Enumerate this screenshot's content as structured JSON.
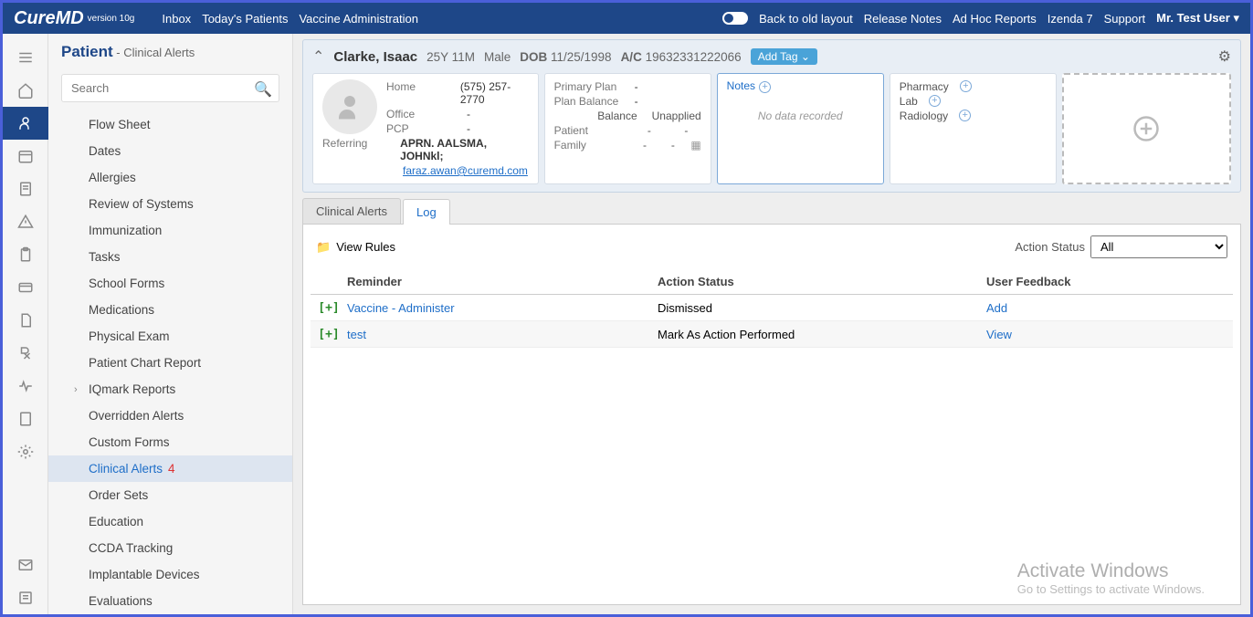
{
  "brand": {
    "name": "CureMD",
    "version": "version 10g"
  },
  "top_nav": [
    "Inbox",
    "Today's Patients",
    "Vaccine Administration"
  ],
  "top_right": {
    "back": "Back to old layout",
    "release": "Release Notes",
    "adhoc": "Ad Hoc Reports",
    "izenda": "Izenda 7",
    "support": "Support",
    "user": "Mr. Test User"
  },
  "sidebar": {
    "title": "Patient",
    "subtitle": " - Clinical Alerts",
    "search_placeholder": "Search",
    "items": [
      {
        "label": "Flow Sheet"
      },
      {
        "label": "Dates"
      },
      {
        "label": "Allergies"
      },
      {
        "label": "Review of Systems"
      },
      {
        "label": "Immunization"
      },
      {
        "label": "Tasks"
      },
      {
        "label": "School Forms"
      },
      {
        "label": "Medications"
      },
      {
        "label": "Physical Exam"
      },
      {
        "label": "Patient Chart Report"
      },
      {
        "label": "IQmark Reports",
        "expandable": true
      },
      {
        "label": "Overridden Alerts"
      },
      {
        "label": "Custom Forms"
      },
      {
        "label": "Clinical Alerts",
        "badge": "4",
        "active": true
      },
      {
        "label": "Order Sets"
      },
      {
        "label": "Education"
      },
      {
        "label": "CCDA Tracking"
      },
      {
        "label": "Implantable Devices"
      },
      {
        "label": "Evaluations"
      }
    ]
  },
  "patient": {
    "name": "Clarke, Isaac",
    "age": "25Y 11M",
    "gender": "Male",
    "dob_label": "DOB",
    "dob": "11/25/1998",
    "ac_label": "A/C",
    "ac": "19632331222066",
    "add_tag": "Add Tag",
    "contact": {
      "home_lbl": "Home",
      "home": "(575) 257-2770",
      "office_lbl": "Office",
      "office": "-",
      "pcp_lbl": "PCP",
      "pcp": "-",
      "ref_lbl": "Referring",
      "ref": "APRN. AALSMA, JOHNkl;",
      "email": "faraz.awan@curemd.com"
    },
    "plan": {
      "primary_lbl": "Primary Plan",
      "primary": "-",
      "balance_lbl": "Plan Balance",
      "balance": "-",
      "bal_hdr": "Balance",
      "unapp_hdr": "Unapplied",
      "patient_lbl": "Patient",
      "patient_bal": "-",
      "patient_un": "-",
      "family_lbl": "Family",
      "family_bal": "-",
      "family_un": "-"
    },
    "notes": {
      "title": "Notes",
      "empty": "No data recorded"
    },
    "orders": {
      "pharmacy": "Pharmacy",
      "lab": "Lab",
      "radiology": "Radiology"
    }
  },
  "tabs": {
    "clinical": "Clinical Alerts",
    "log": "Log"
  },
  "log": {
    "view_rules": "View Rules",
    "status_label": "Action Status",
    "status_value": "All",
    "columns": {
      "reminder": "Reminder",
      "status": "Action Status",
      "feedback": "User Feedback"
    },
    "rows": [
      {
        "reminder": "Vaccine - Administer",
        "status": "Dismissed",
        "feedback": "Add"
      },
      {
        "reminder": "test",
        "status": "Mark As Action Performed",
        "feedback": "View"
      }
    ]
  },
  "watermark": {
    "title": "Activate Windows",
    "sub": "Go to Settings to activate Windows."
  }
}
